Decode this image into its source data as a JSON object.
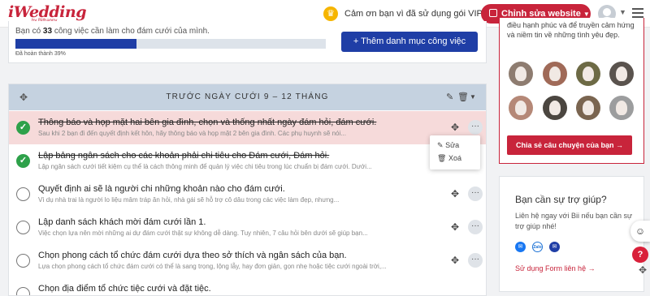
{
  "header": {
    "logo": "iWedding",
    "logo_sub": "by Bithappy",
    "vip_message": "Cảm ơn bạn vì đã sử dụng gói VIP!",
    "edit_site_label": "Chỉnh sửa website",
    "colors": {
      "brand": "#c8243b",
      "crown": "#f6b500"
    }
  },
  "progress": {
    "text_prefix": "Bạn có",
    "count": "33",
    "text_suffix": "công việc cần làm cho đám cưới của mình.",
    "percent_label": "Đã hoàn thành 39%",
    "percent": 39,
    "add_category_label": "+ Thêm danh mục công việc"
  },
  "phase": {
    "title": "TRƯỚC NGÀY CƯỚI 9 – 12 THÁNG"
  },
  "tasks": [
    {
      "title": "Thông báo và họp mặt hai bên gia đình, chọn và thống nhất ngày đám hỏi, đám cưới.",
      "desc": "Sau khi 2 bạn đi đến quyết định kết hôn, hãy thông báo và họp mặt 2 bên gia đình. Các phụ huynh sẽ nói...",
      "done": true
    },
    {
      "title": "Lập bảng ngân sách cho các khoản phải chi tiêu cho Đám cưới, Đám hỏi.",
      "desc": "Lập ngân sách cưới tiết kiệm cụ thể là cách thông minh để quản lý việc chi tiêu trong lúc chuẩn bị đám cưới. Dưới...",
      "done": true
    },
    {
      "title": "Quyết định ai sẽ là người chi những khoản nào cho đám cưới.",
      "desc": "Vì dụ nhà trai là người lo liệu mâm tráp ăn hỏi, nhà gái sẽ hỗ trợ cô dâu trong các việc làm đẹp, nhưng...",
      "done": false
    },
    {
      "title": "Lập danh sách khách mời đám cưới lần 1.",
      "desc": "Việc chọn lựa nên mời những ai dự đám cưới thật sự không dễ dàng. Tuy nhiên, 7 câu hỏi bên dưới sẽ giúp bạn...",
      "done": false
    },
    {
      "title": "Chọn phong cách tổ chức đám cưới dựa theo sở thích và ngân sách của bạn.",
      "desc": "Lựa chọn phong cách tổ chức đám cưới có thể là sang trọng, lộng lẫy, hay đơn giản, gọn nhẹ hoặc tiệc cưới ngoài trời,...",
      "done": false
    },
    {
      "title": "Chọn địa điểm tổ chức tiệc cưới và đặt tiệc.",
      "desc": "",
      "done": false
    }
  ],
  "row_menu": {
    "edit_label": "Sửa",
    "delete_label": "Xoá"
  },
  "story": {
    "text": "điều hạnh phúc và để truyền cảm hứng và niềm tin về những tình yêu đẹp.",
    "share_label": "Chia sẻ câu chuyện của bạn →"
  },
  "support": {
    "title": "Bạn cần sự trợ giúp?",
    "text": "Liên hệ ngay với Bii nếu bạn cần sự trợ giúp nhé!",
    "icons": [
      "messenger-icon",
      "zalo-icon",
      "email-icon"
    ],
    "link_label": "Sử dụng Form liên hệ →"
  }
}
